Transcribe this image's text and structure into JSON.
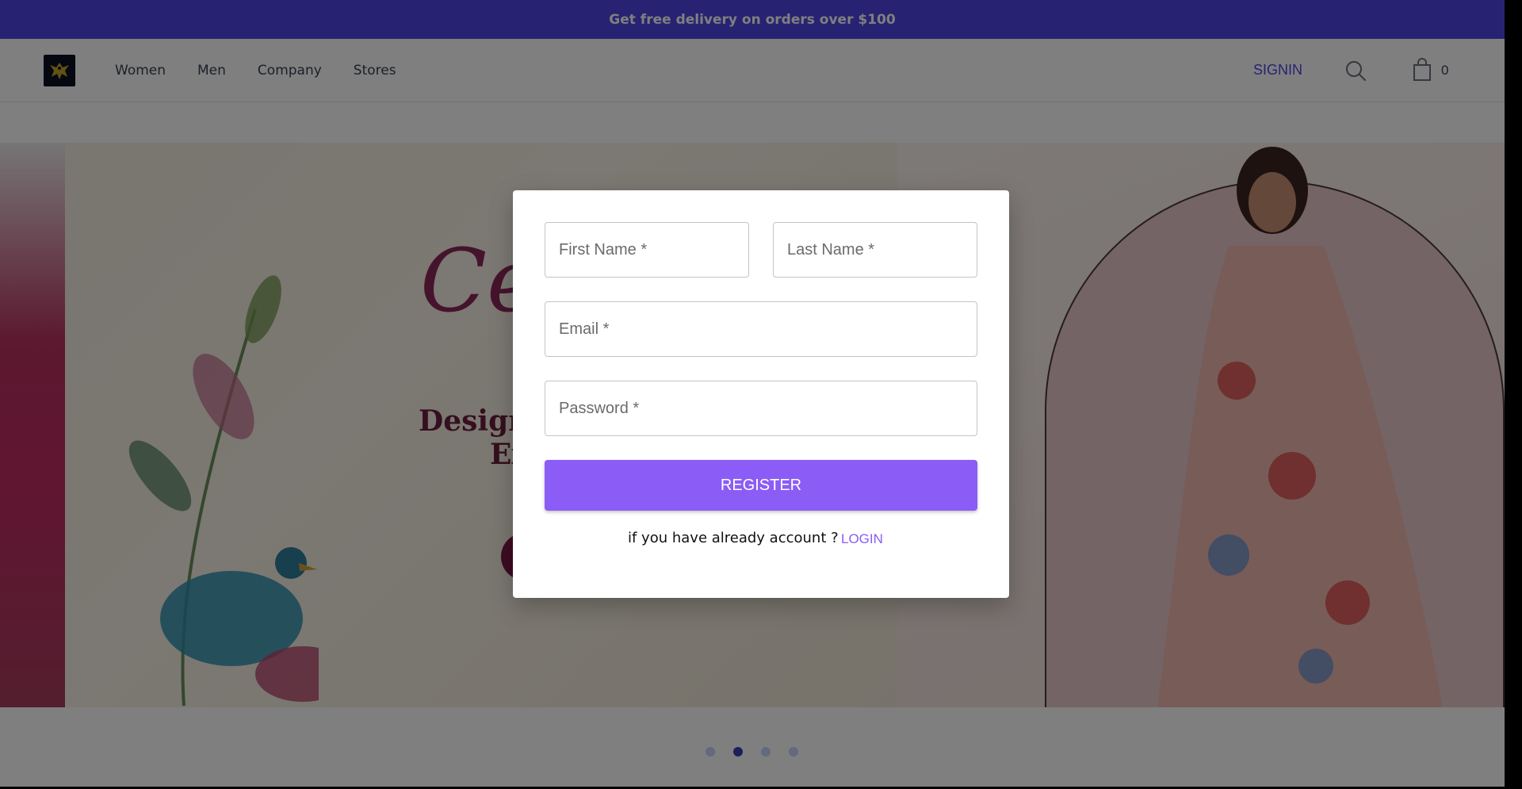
{
  "announcement": {
    "text": "Get free delivery on orders over $100"
  },
  "header": {
    "logo_icon": "phoenix-logo-icon",
    "nav": [
      {
        "label": "Women"
      },
      {
        "label": "Men"
      },
      {
        "label": "Company"
      },
      {
        "label": "Stores"
      }
    ],
    "signin_label": "SIGNIN",
    "search_icon": "search-icon",
    "cart_icon": "shopping-bag-icon",
    "cart_count": "0"
  },
  "hero": {
    "script_text": "Ce",
    "headline_line1": "Design",
    "headline_line2": "Ex"
  },
  "carousel": {
    "total": 4,
    "active_index": 1
  },
  "register_modal": {
    "first_name_placeholder": "First Name *",
    "last_name_placeholder": "Last Name *",
    "email_placeholder": "Email *",
    "password_placeholder": "Password *",
    "register_label": "REGISTER",
    "already_text": "if you have already account ?",
    "login_label": "LOGIN"
  },
  "colors": {
    "brand": "#4f46e5",
    "button": "#8b5cf6",
    "overlay": "rgba(0,0,0,0.5)"
  }
}
